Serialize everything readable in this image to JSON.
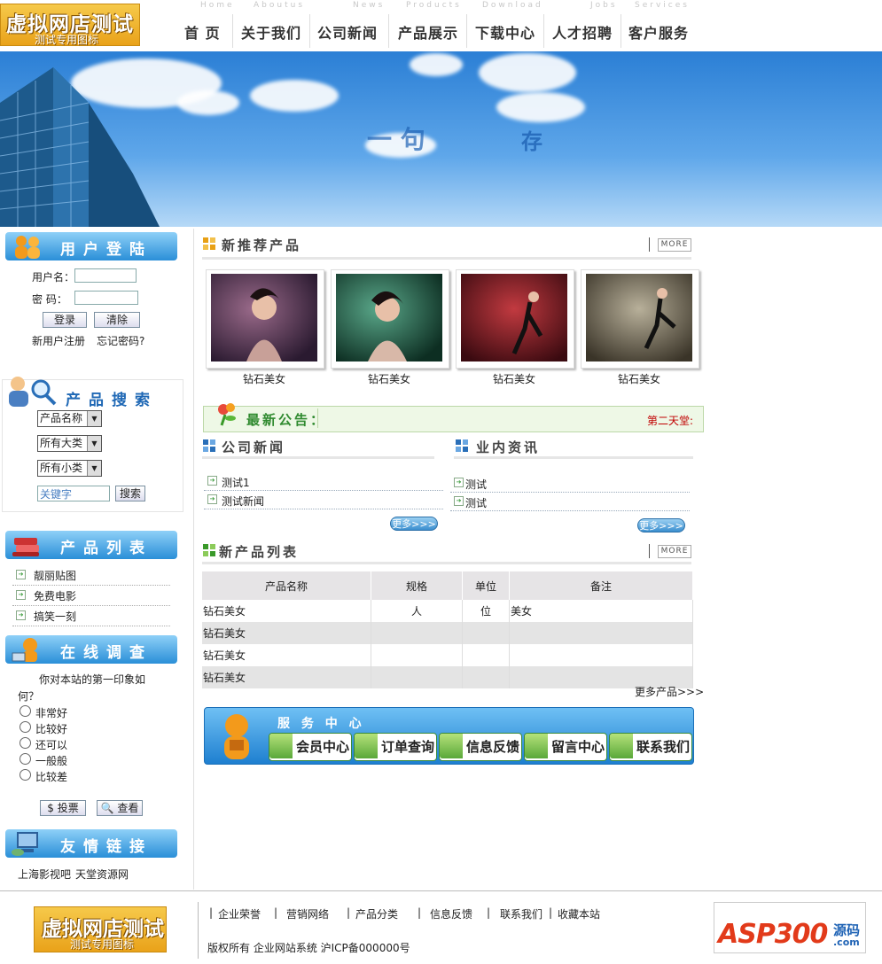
{
  "header": {
    "logo": {
      "title": "虚拟网店测试",
      "subtitle": "测试专用图标"
    },
    "nav": [
      {
        "en": "Home",
        "label": "首  页"
      },
      {
        "en": "Aboutus",
        "label": "关于我们"
      },
      {
        "en": "News",
        "label": "公司新闻"
      },
      {
        "en": "Products",
        "label": "产品展示"
      },
      {
        "en": "Download",
        "label": "下载中心"
      },
      {
        "en": "Jobs",
        "label": "人才招聘"
      },
      {
        "en": "Services",
        "label": "客户服务"
      }
    ]
  },
  "banner": {
    "text1": "一 句",
    "text2": "存"
  },
  "login": {
    "heading": "用户登陆",
    "username_label": "用户名：",
    "password_label": "密  码：",
    "login_button": "登录",
    "clear_button": "清除",
    "register_link": "新用户注册",
    "forgot_link": "忘记密码?"
  },
  "search": {
    "heading": "产品搜索",
    "select_name": "产品名称",
    "select_big": "所有大类",
    "select_small": "所有小类",
    "keyword_placeholder": "关键字",
    "search_button": "搜索"
  },
  "product_list": {
    "heading": "产品列表",
    "items": [
      "靓丽贴图",
      "免费电影",
      "搞笑一刻"
    ]
  },
  "survey": {
    "heading": "在线调查",
    "question_line1": "你对本站的第一印象如",
    "question_line2": "何？",
    "options": [
      "非常好",
      "比较好",
      "还可以",
      "一般般",
      "比较差"
    ],
    "vote_button": "投票",
    "view_button": "查看"
  },
  "links": {
    "heading": "友情链接",
    "items": [
      "上海影视吧",
      "天堂资源网"
    ]
  },
  "recommend": {
    "heading": "新推荐产品",
    "more": "MORE",
    "products": [
      "钻石美女",
      "钻石美女",
      "钻石美女",
      "钻石美女"
    ]
  },
  "notice": {
    "heading": "最新公告：",
    "text": "第二天堂:"
  },
  "company_news": {
    "heading": "公司新闻",
    "items": [
      "测试1",
      "测试新闻"
    ],
    "more": "更多>>>"
  },
  "industry_news": {
    "heading": "业内资讯",
    "items": [
      "测试",
      "测试"
    ],
    "more": "更多>>>"
  },
  "new_products": {
    "heading": "新产品列表",
    "more": "MORE",
    "columns": [
      "产品名称",
      "规格",
      "单位",
      "备注"
    ],
    "rows": [
      [
        "钻石美女",
        "人",
        "位",
        "美女"
      ],
      [
        "钻石美女",
        "",
        "",
        ""
      ],
      [
        "钻石美女",
        "",
        "",
        ""
      ],
      [
        "钻石美女",
        "",
        "",
        ""
      ]
    ],
    "more_products": "更多产品>>>"
  },
  "service": {
    "heading": "服 务 中 心",
    "items": [
      "会员中心",
      "订单查询",
      "信息反馈",
      "留言中心",
      "联系我们"
    ]
  },
  "footer": {
    "links": [
      "企业荣誉",
      "营销网络",
      "产品分类",
      "信息反馈",
      "联系我们",
      "收藏本站"
    ],
    "copyright": "版权所有  企业网站系统  沪ICP备000000号",
    "asp_logo": "ASP300",
    "asp_sub": "源码",
    "asp_com": ".com"
  },
  "colors": {
    "accent_blue": "#2a8fd8",
    "logo_gold": "#e9a21a",
    "notice_red": "#c00000"
  }
}
